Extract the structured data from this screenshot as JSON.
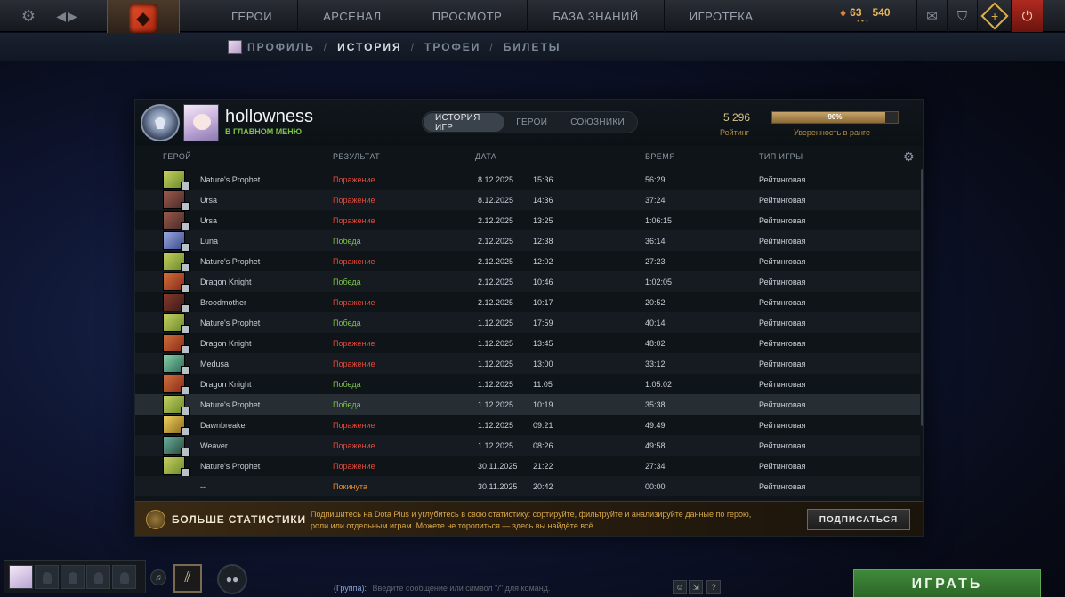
{
  "topbar": {
    "nav": [
      "ГЕРОИ",
      "АРСЕНАЛ",
      "ПРОСМОТР",
      "БАЗА ЗНАНИЙ",
      "ИГРОТЕКА"
    ],
    "shards": "63",
    "currency": "540"
  },
  "subnav": {
    "items": [
      "ПРОФИЛЬ",
      "ИСТОРИЯ",
      "ТРОФЕИ",
      "БИЛЕТЫ"
    ],
    "active": "ИСТОРИЯ"
  },
  "profile": {
    "username": "hollowness",
    "status": "В ГЛАВНОМ МЕНЮ",
    "tabs": [
      "ИСТОРИЯ ИГР",
      "ГЕРОИ",
      "СОЮЗНИКИ"
    ],
    "rating_value": "5 296",
    "rating_label": "Рейтинг",
    "confidence": "90%",
    "confidence_fraction": 0.9,
    "confidence_label": "Уверенность в ранге"
  },
  "columns": {
    "hero": "ГЕРОЙ",
    "result": "РЕЗУЛЬТАТ",
    "date": "ДАТА",
    "duration": "ВРЕМЯ",
    "game_type": "ТИП ИГРЫ"
  },
  "matches": [
    {
      "hero": "Nature's Prophet",
      "result": "Поражение",
      "date": "8.12.2025",
      "time": "15:36",
      "duration": "56:29",
      "type": "Рейтинговая"
    },
    {
      "hero": "Ursa",
      "result": "Поражение",
      "date": "8.12.2025",
      "time": "14:36",
      "duration": "37:24",
      "type": "Рейтинговая"
    },
    {
      "hero": "Ursa",
      "result": "Поражение",
      "date": "2.12.2025",
      "time": "13:25",
      "duration": "1:06:15",
      "type": "Рейтинговая"
    },
    {
      "hero": "Luna",
      "result": "Победа",
      "date": "2.12.2025",
      "time": "12:38",
      "duration": "36:14",
      "type": "Рейтинговая"
    },
    {
      "hero": "Nature's Prophet",
      "result": "Поражение",
      "date": "2.12.2025",
      "time": "12:02",
      "duration": "27:23",
      "type": "Рейтинговая"
    },
    {
      "hero": "Dragon Knight",
      "result": "Победа",
      "date": "2.12.2025",
      "time": "10:46",
      "duration": "1:02:05",
      "type": "Рейтинговая"
    },
    {
      "hero": "Broodmother",
      "result": "Поражение",
      "date": "2.12.2025",
      "time": "10:17",
      "duration": "20:52",
      "type": "Рейтинговая"
    },
    {
      "hero": "Nature's Prophet",
      "result": "Победа",
      "date": "1.12.2025",
      "time": "17:59",
      "duration": "40:14",
      "type": "Рейтинговая"
    },
    {
      "hero": "Dragon Knight",
      "result": "Поражение",
      "date": "1.12.2025",
      "time": "13:45",
      "duration": "48:02",
      "type": "Рейтинговая"
    },
    {
      "hero": "Medusa",
      "result": "Поражение",
      "date": "1.12.2025",
      "time": "13:00",
      "duration": "33:12",
      "type": "Рейтинговая"
    },
    {
      "hero": "Dragon Knight",
      "result": "Победа",
      "date": "1.12.2025",
      "time": "11:05",
      "duration": "1:05:02",
      "type": "Рейтинговая"
    },
    {
      "hero": "Nature's Prophet",
      "result": "Победа",
      "date": "1.12.2025",
      "time": "10:19",
      "duration": "35:38",
      "type": "Рейтинговая"
    },
    {
      "hero": "Dawnbreaker",
      "result": "Поражение",
      "date": "1.12.2025",
      "time": "09:21",
      "duration": "49:49",
      "type": "Рейтинговая"
    },
    {
      "hero": "Weaver",
      "result": "Поражение",
      "date": "1.12.2025",
      "time": "08:26",
      "duration": "49:58",
      "type": "Рейтинговая"
    },
    {
      "hero": "Nature's Prophet",
      "result": "Поражение",
      "date": "30.11.2025",
      "time": "21:22",
      "duration": "27:34",
      "type": "Рейтинговая"
    },
    {
      "hero": "--",
      "result": "Покинута",
      "date": "30.11.2025",
      "time": "20:42",
      "duration": "00:00",
      "type": "Рейтинговая"
    }
  ],
  "promo": {
    "title": "БОЛЬШЕ СТАТИСТИКИ",
    "text": "Подпишитесь на Dota Plus и углубитесь в свою статистику: сортируйте, фильтруйте и анализируйте данные по герою, роли или отдельным играм. Можете не торопиться — здесь вы найдёте всё.",
    "button": "ПОДПИСАТЬСЯ"
  },
  "bottom": {
    "chat_channel": "(Группа):",
    "chat_placeholder": "Введите сообщение или символ \"/\" для команд.",
    "play": "ИГРАТЬ"
  },
  "colors": {
    "win": "#7cc14a",
    "loss": "#e64a3a",
    "abandon": "#e88a2a",
    "accent_gold": "#d9a84a",
    "play_green": "#3f8a3a"
  },
  "hero_icon_colors": {
    "Nature's Prophet": [
      "#6a8a2a",
      "#c8d060"
    ],
    "Ursa": [
      "#4a2a2a",
      "#9a5a4a"
    ],
    "Luna": [
      "#3a4a8a",
      "#9aa8e0"
    ],
    "Dragon Knight": [
      "#8a2a1a",
      "#d0703a"
    ],
    "Broodmother": [
      "#3a1a1a",
      "#8a3a2a"
    ],
    "Medusa": [
      "#2a6a5a",
      "#8ad0a8"
    ],
    "Dawnbreaker": [
      "#8a6a1a",
      "#f0d060"
    ],
    "Weaver": [
      "#2a4a3a",
      "#6ab0a0"
    ]
  }
}
